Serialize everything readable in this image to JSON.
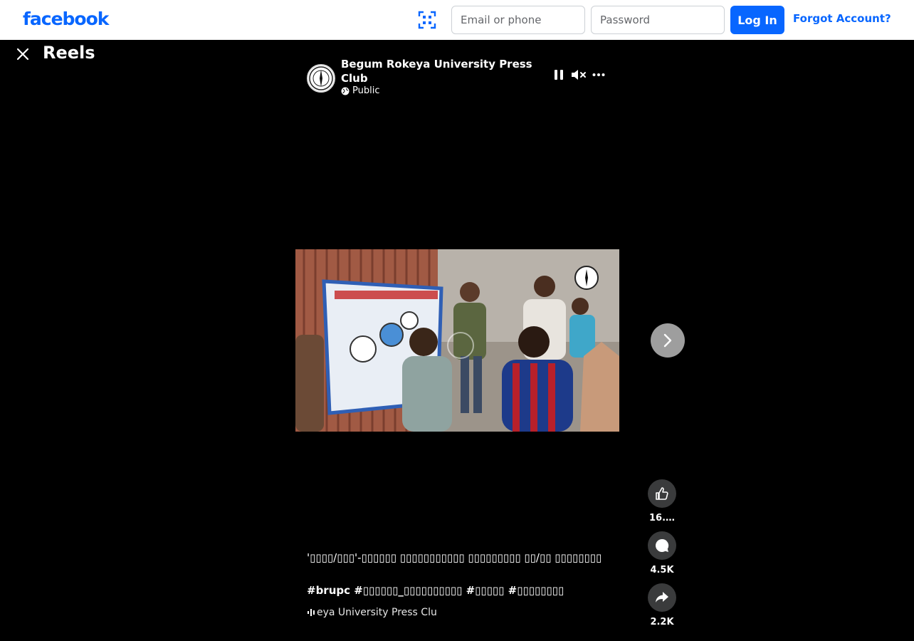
{
  "brand": {
    "logo_text": "facebook",
    "color": "#0866ff"
  },
  "login": {
    "email_placeholder": "Email or phone",
    "password_placeholder": "Password",
    "login_label": "Log In",
    "forgot_label": "Forgot Account?"
  },
  "reels": {
    "title": "Reels"
  },
  "post": {
    "page_name": "Begum Rokeya University Press Club",
    "privacy": "Public",
    "caption": "'▯▯▯▯/▯▯▯'-▯▯▯▯▯▯ ▯▯▯▯▯▯▯▯▯▯▯ ▯▯▯▯▯▯▯▯▯ ▯▯/▯▯ ▯▯▯▯▯▯▯▯",
    "hashtags": "#brupc #▯▯▯▯▯▯_▯▯▯▯▯▯▯▯▯▯ #▯▯▯▯▯ #▯▯▯▯▯▯▯▯",
    "audio_text": "eya University Press Clu"
  },
  "actions": {
    "likes": "16.…",
    "comments": "4.5K",
    "shares": "2.2K"
  },
  "icons": {
    "close": "close-icon",
    "scan": "qr-scan-icon",
    "pause": "pause-icon",
    "mute": "muted-speaker-icon",
    "more": "more-icon",
    "next": "chevron-right-icon",
    "like": "thumbs-up-icon",
    "comment": "comment-icon",
    "share": "share-icon",
    "globe": "globe-icon",
    "audio": "audio-wave-icon"
  }
}
